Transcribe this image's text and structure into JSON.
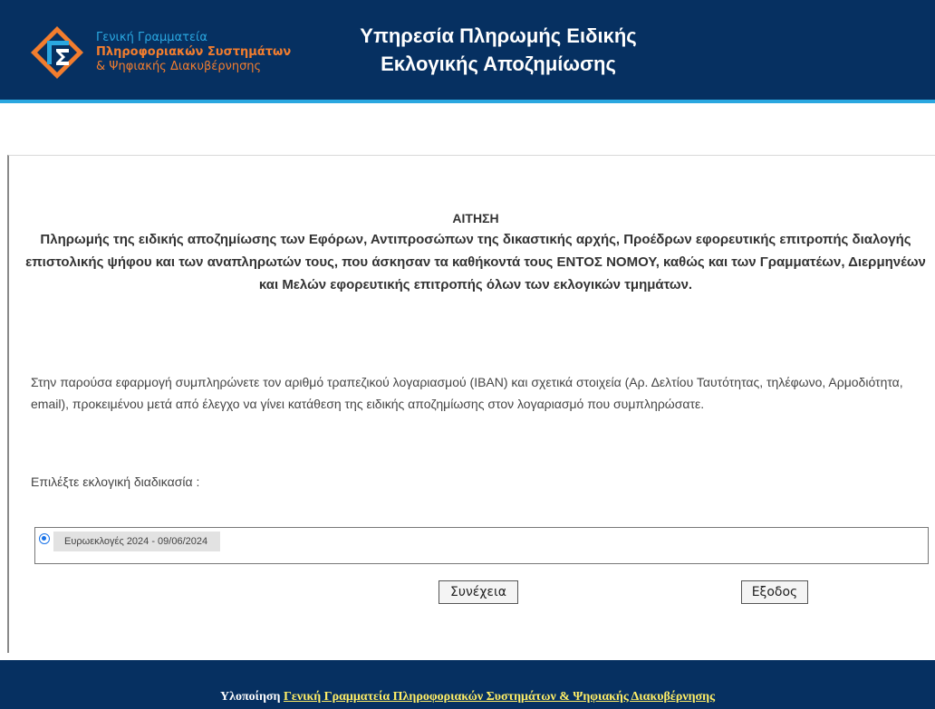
{
  "header": {
    "logo_line1": "Γενική Γραμματεία",
    "logo_line2": "Πληροφοριακών Συστημάτων",
    "logo_line3": "& Ψηφιακής Διακυβέρνησης",
    "title_line1": "Υπηρεσία Πληρωμής Ειδικής",
    "title_line2": "Εκλογικής Αποζημίωσης"
  },
  "main": {
    "heading": "ΑΙΤΗΣΗ",
    "description": "Πληρωμής της ειδικής αποζημίωσης των Εφόρων, Αντιπροσώπων της δικαστικής αρχής, Προέδρων εφορευτικής επιτροπής διαλογής επιστολικής ψήφου και των αναπληρωτών τους, που άσκησαν τα καθήκοντά τους ΕΝΤΟΣ ΝΟΜΟΥ, καθώς και των Γραμματέων, Διερμηνέων και Μελών εφορευτικής επιτροπής όλων των εκλογικών τμημάτων.",
    "intro": "Στην παρούσα εφαρμογή συμπληρώνετε τον αριθμό τραπεζικού λογαριασμού (IBAN) και σχετικά στοιχεία (Αρ. Δελτίου Ταυτότητας, τηλέφωνο, Αρμοδιότητα, email), προκειμένου μετά από έλεγχο να γίνει κατάθεση της ειδικής αποζημίωσης στον λογαριασμό που συμπληρώσατε.",
    "choose_label": "Επιλέξτε εκλογική διαδικασία :",
    "options": [
      {
        "label": "Ευρωεκλογές 2024 - 09/06/2024",
        "selected": true
      }
    ],
    "continue_button": "Συνέχεια",
    "exit_button": "Εξοδος"
  },
  "footer": {
    "prefix": "Υλοποίηση",
    "link_text": "Γενική Γραμματεία Πληροφοριακών Συστημάτων & Ψηφιακής Διακυβέρνησης"
  },
  "colors": {
    "header_bg": "#063061",
    "accent_blue": "#2aa7e0",
    "accent_orange": "#f27d2e",
    "footer_link": "#ffee66"
  }
}
